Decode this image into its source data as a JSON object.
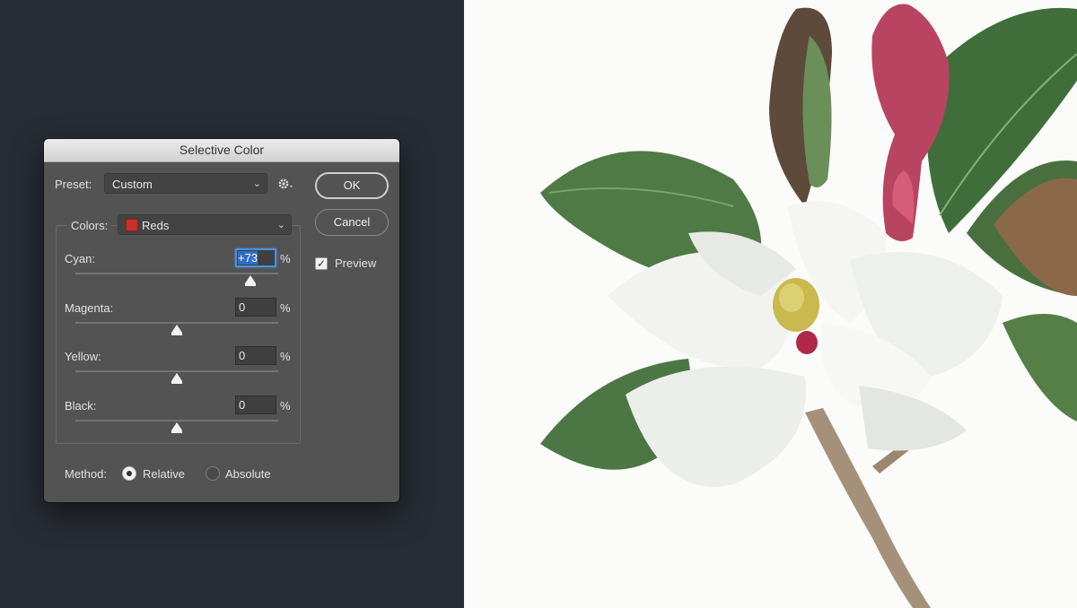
{
  "dialog": {
    "title": "Selective Color",
    "preset_label": "Preset:",
    "preset_value": "Custom",
    "colors_label": "Colors:",
    "colors_value": "Reds",
    "colors_swatch": "#c9302c",
    "sliders": [
      {
        "label": "Cyan:",
        "value": "+73",
        "unit": "%",
        "level": 73
      },
      {
        "label": "Magenta:",
        "value": "0",
        "unit": "%",
        "level": 0
      },
      {
        "label": "Yellow:",
        "value": "0",
        "unit": "%",
        "level": 0
      },
      {
        "label": "Black:",
        "value": "0",
        "unit": "%",
        "level": 0
      }
    ],
    "method_label": "Method:",
    "method_relative": "Relative",
    "method_absolute": "Absolute",
    "method_selected": "Relative",
    "ok_label": "OK",
    "cancel_label": "Cancel",
    "preview_label": "Preview",
    "preview_checked": true,
    "settings_icon": "gear-icon",
    "checkmark": "✓"
  }
}
